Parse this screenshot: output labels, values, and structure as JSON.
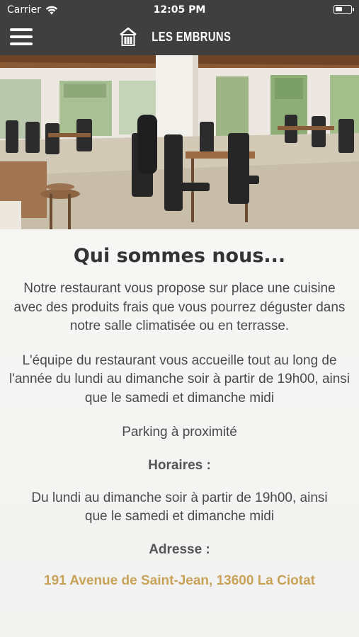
{
  "status_bar": {
    "carrier": "Carrier",
    "time": "12:05 PM"
  },
  "nav": {
    "brand": "LES EMBRUNS",
    "colors": {
      "bar": "#3f3f3f",
      "text": "#ffffff"
    }
  },
  "content": {
    "title": "Qui sommes nous...",
    "intro": "Notre restaurant vous propose sur place  une cuisine avec des produits frais que vous pourrez déguster dans notre salle climatisée ou en terrasse.",
    "team": "L'équipe du restaurant  vous accueille tout au long de l'année du lundi au dimanche soir à partir de 19h00, ainsi que le samedi et dimanche midi",
    "parking": "Parking à proximité",
    "hours_label": "Horaires :",
    "hours": "Du lundi au dimanche soir à partir de 19h00, ainsi que le samedi et dimanche midi",
    "address_label": "Adresse :",
    "address": "191 Avenue de Saint-Jean, 13600 La Ciotat",
    "colors": {
      "address": "#c9a25a"
    }
  }
}
